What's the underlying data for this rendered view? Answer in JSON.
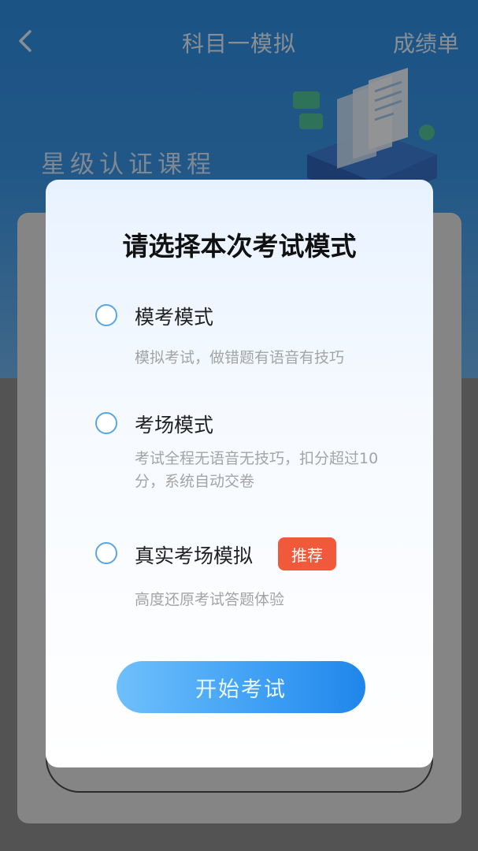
{
  "header": {
    "back_icon": "chevron-left-icon",
    "title": "科目一模拟",
    "report_label": "成绩单"
  },
  "hero": {
    "course_label": "星级认证课程"
  },
  "dialog": {
    "title": "请选择本次考试模式",
    "options": [
      {
        "label": "模考模式",
        "desc": "模拟考试，做错题有语音有技巧",
        "selected": false
      },
      {
        "label": "考场模式",
        "desc": "考试全程无语音无技巧，扣分超过10分，系统自动交卷",
        "selected": false
      },
      {
        "label": "真实考场模拟",
        "desc": "高度还原考试答题体验",
        "selected": false,
        "badge": "推荐"
      }
    ],
    "start_label": "开始考试"
  },
  "colors": {
    "header_blue": "#2f8fe6",
    "radio_border": "#5aa6e0",
    "badge_red": "#f05a3a",
    "button_gradient_start": "#6ec0fb",
    "button_gradient_end": "#1f86ea"
  }
}
